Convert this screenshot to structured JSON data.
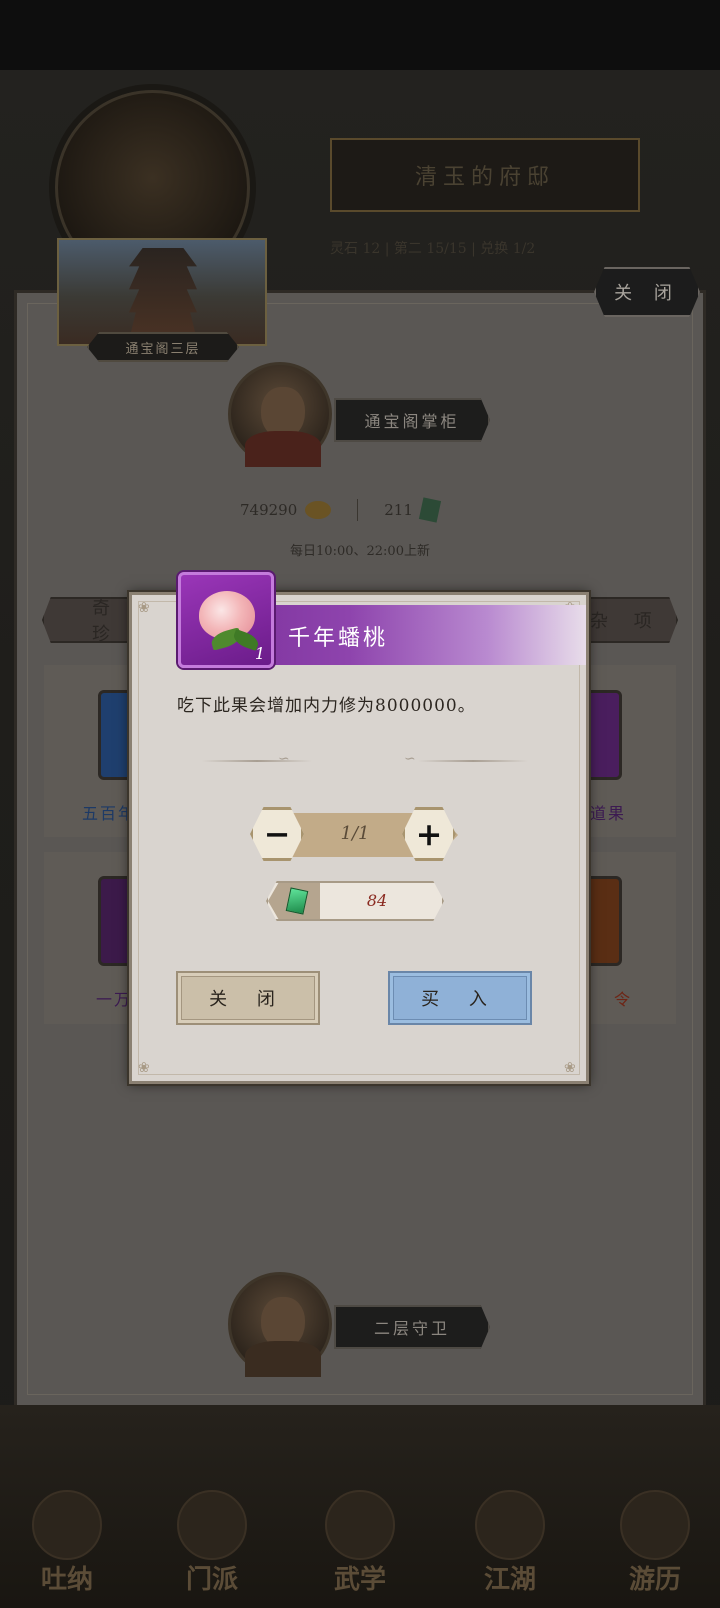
{
  "background": {
    "scene_title": "清玉的府邸",
    "scene_stats": "灵石 12 | 第二 15/15 | 兑换 1/2",
    "floor_label": "通宝阁三层",
    "close_label": "关 闭",
    "keeper_name": "通宝阁掌柜",
    "gold": "749290",
    "jade": "211",
    "refresh_text": "每日10:00、22:00上新",
    "tab_left": "奇 珍",
    "tab_right": "杂 项",
    "items": [
      {
        "name": "五百年",
        "color": "#1f3f6e"
      },
      {
        "name": "道果",
        "color": "#4a1e5e"
      },
      {
        "name": "一万",
        "color": "#3c1a4a"
      },
      {
        "name": "令",
        "color": "#5a2e14"
      }
    ],
    "guard_name": "二层守卫",
    "nav": [
      "吐纳",
      "门派",
      "武学",
      "江湖",
      "游历"
    ]
  },
  "modal": {
    "item_name": "千年蟠桃",
    "item_qty": "1",
    "description": "吃下此果会增加内力修为8000000。",
    "stepper": {
      "minus": "−",
      "value": "1/1",
      "plus": "+"
    },
    "price": "84",
    "close_button": "关 闭",
    "buy_button": "买 入",
    "colors": {
      "header": "#8e44ad",
      "buy": "#8fb1d7",
      "close": "#cbbfa9"
    }
  }
}
